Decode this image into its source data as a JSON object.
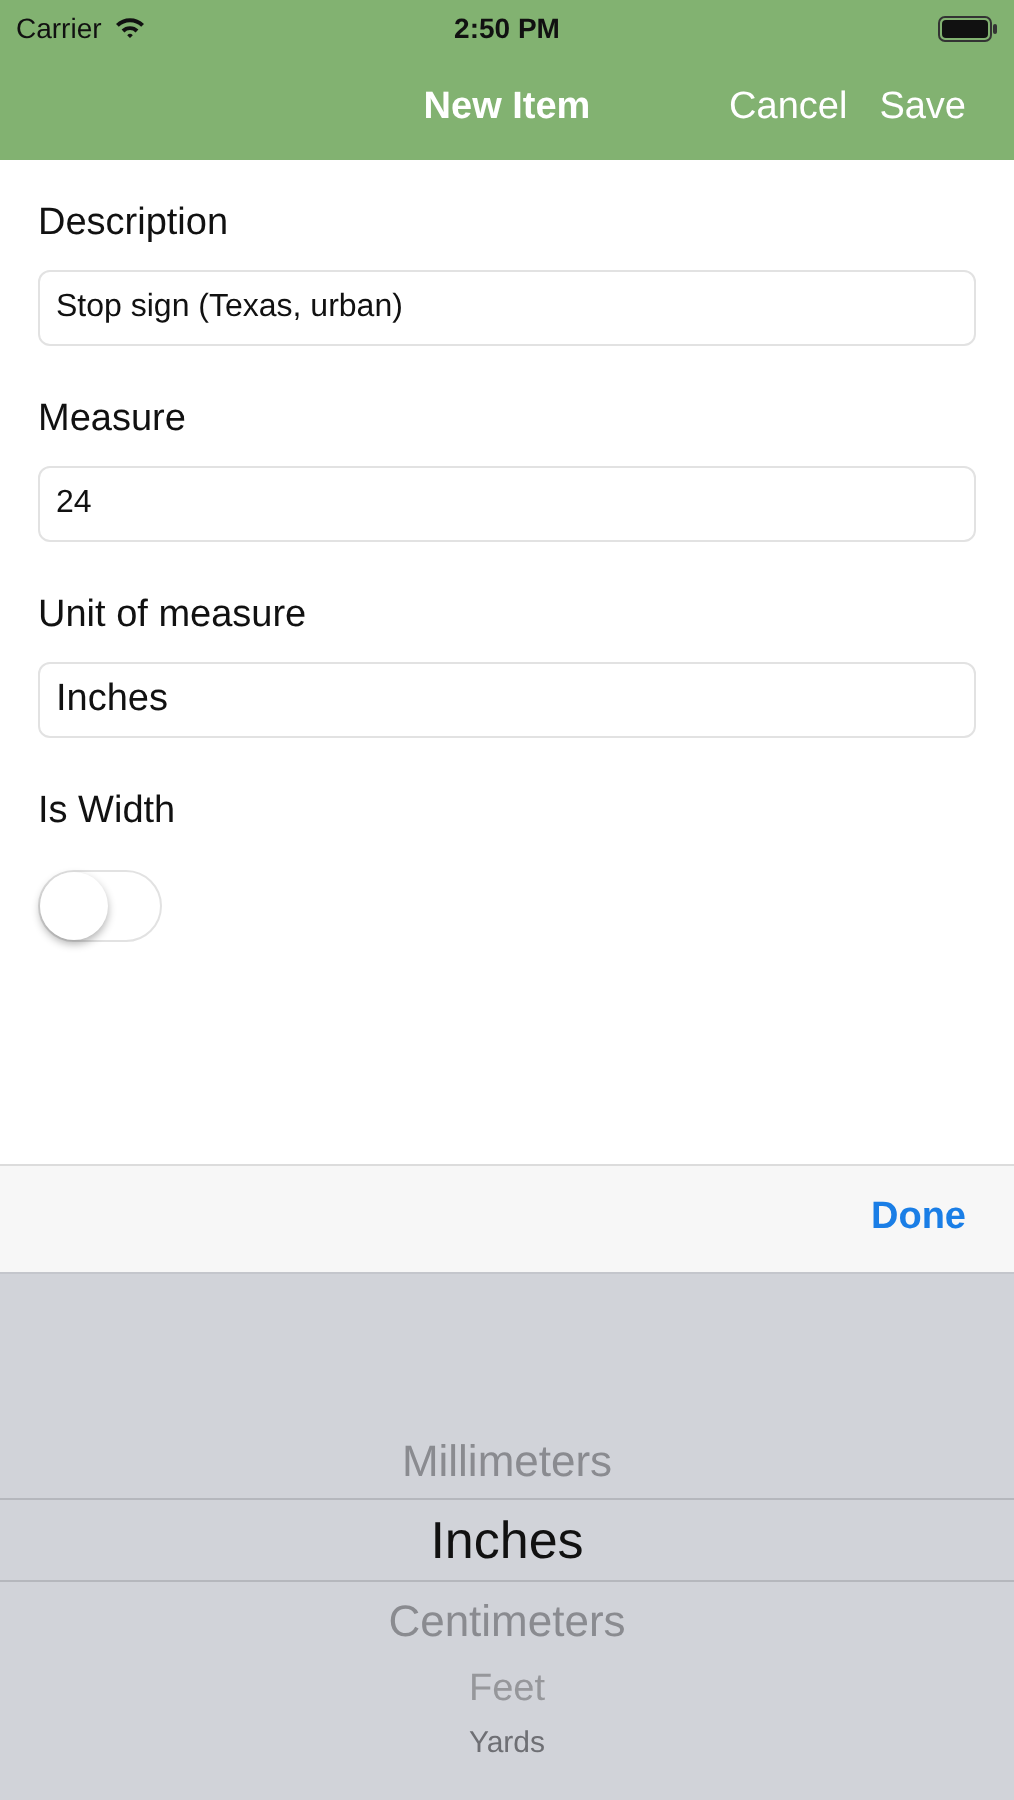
{
  "status_bar": {
    "carrier": "Carrier",
    "time": "2:50 PM"
  },
  "nav": {
    "title": "New Item",
    "actions": [
      "Cancel",
      "Save"
    ]
  },
  "form": [
    {
      "kind": "text",
      "label": "Description",
      "value": "Stop sign (Texas, urban)"
    },
    {
      "kind": "text",
      "label": "Measure",
      "value": "24"
    },
    {
      "kind": "select",
      "label": "Unit of measure",
      "value": "Inches"
    },
    {
      "kind": "switch",
      "label": "Is Width",
      "on": false
    }
  ],
  "toolbar": {
    "done": "Done"
  },
  "picker": [
    {
      "label": "Millimeters",
      "selected": false
    },
    {
      "label": "Inches",
      "selected": true
    },
    {
      "label": "Centimeters",
      "selected": false
    },
    {
      "label": "Feet",
      "selected": false
    },
    {
      "label": "Yards",
      "selected": false
    }
  ]
}
